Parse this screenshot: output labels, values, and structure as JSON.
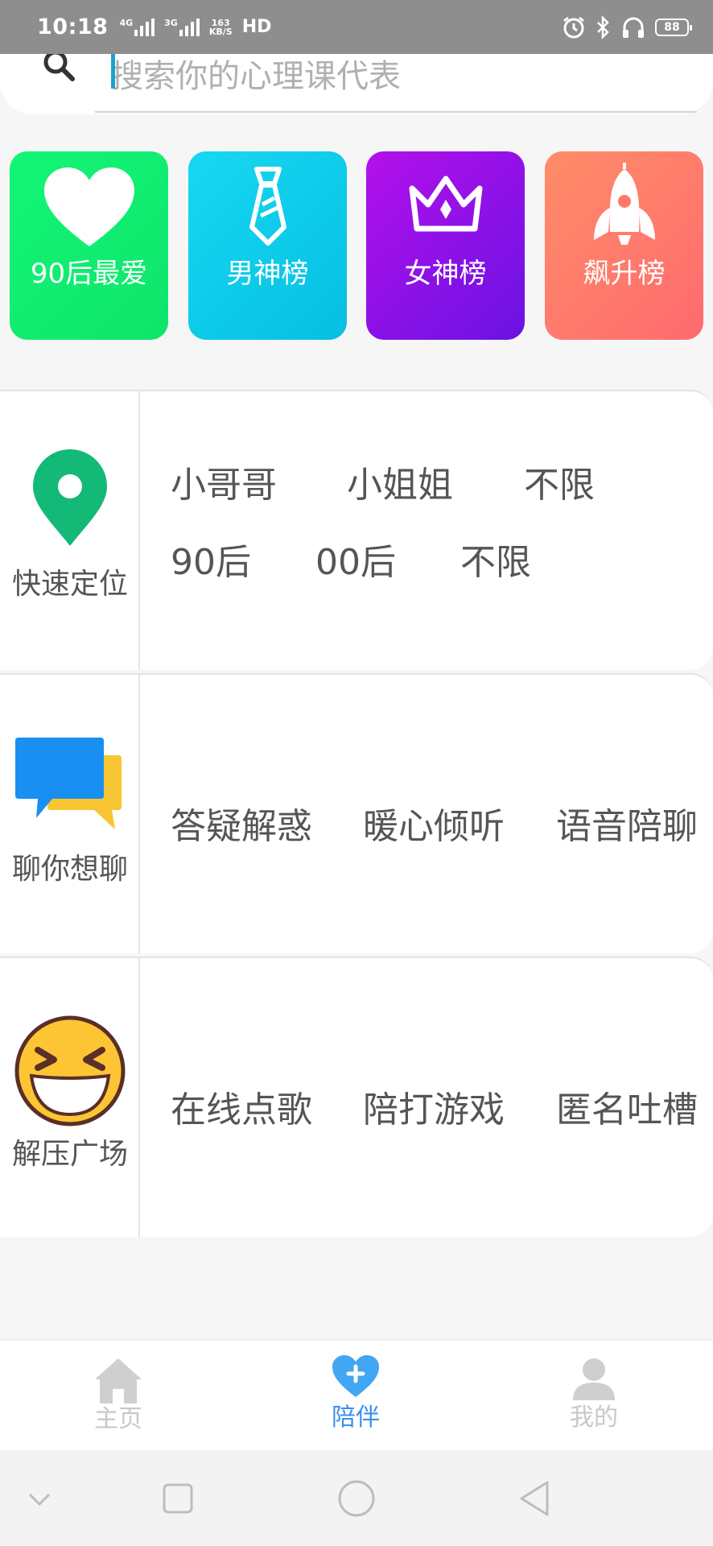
{
  "status_bar": {
    "time": "10:18",
    "sim1_tag": "4G",
    "sim2_tag": "3G",
    "speed_value": "163",
    "speed_unit": "KB/S",
    "hd_label": "HD",
    "battery_level": "88"
  },
  "search": {
    "placeholder": "搜索你的心理课代表"
  },
  "categories": [
    {
      "label": "90后最爱",
      "icon": "heart-icon",
      "color": "#13f577"
    },
    {
      "label": "男神榜",
      "icon": "necktie-icon",
      "color": "#17d8f2"
    },
    {
      "label": "女神榜",
      "icon": "crown-icon",
      "color": "#8a10e6"
    },
    {
      "label": "飙升榜",
      "icon": "rocket-icon",
      "color": "#ff7a6b"
    }
  ],
  "sections": {
    "locate": {
      "label": "快速定位",
      "icon": "location-pin-icon",
      "row1": [
        "小哥哥",
        "小姐姐",
        "不限"
      ],
      "row2": [
        "90后",
        "00后",
        "不限"
      ]
    },
    "chat": {
      "label": "聊你想聊",
      "icon": "chat-bubbles-icon",
      "options": [
        "答疑解惑",
        "暖心倾听",
        "语音陪聊"
      ]
    },
    "relax": {
      "label": "解压广场",
      "icon": "laughing-face-icon",
      "options": [
        "在线点歌",
        "陪打游戏",
        "匿名吐槽"
      ]
    }
  },
  "bottom_nav": {
    "home": "主页",
    "company": "陪伴",
    "mine": "我的",
    "active": "company",
    "active_color": "#3a8ff0"
  }
}
